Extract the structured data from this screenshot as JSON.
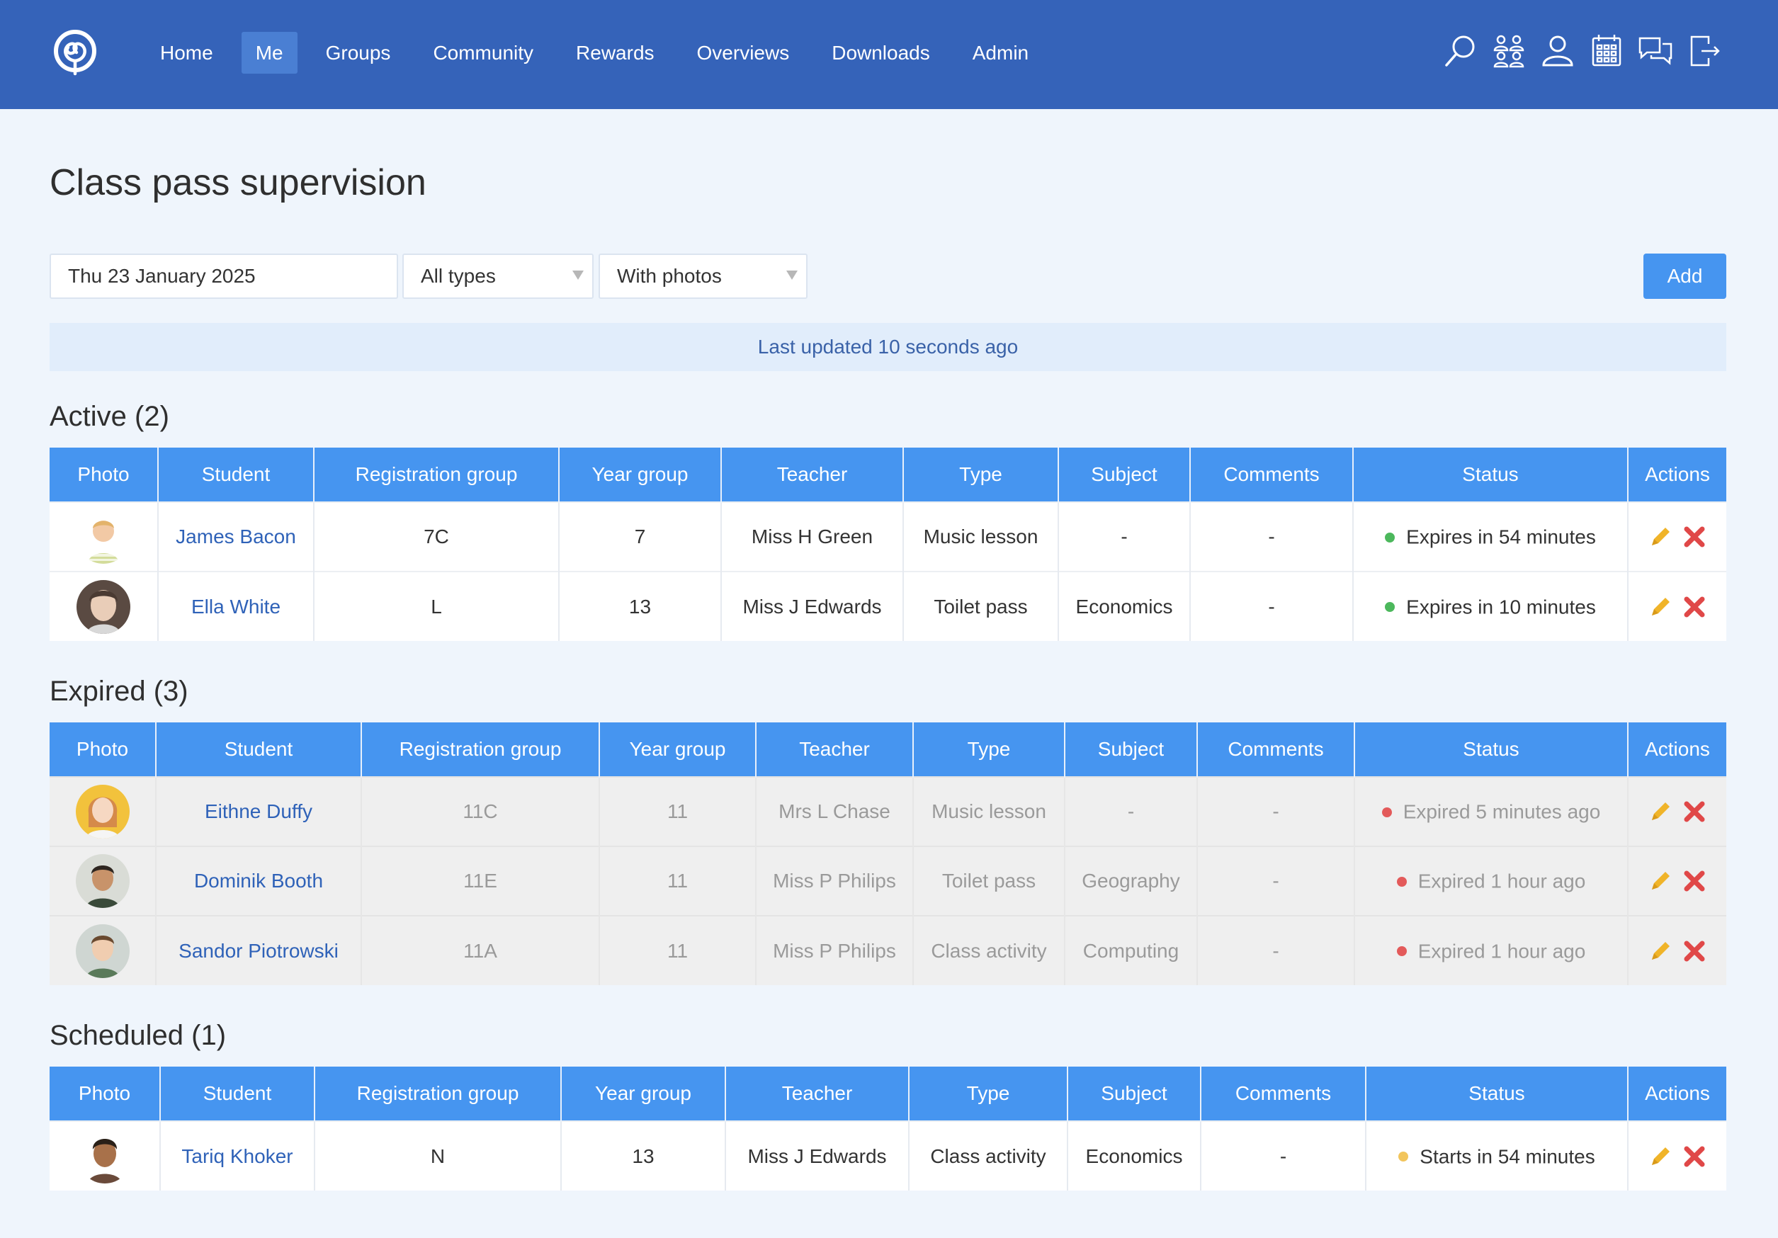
{
  "nav": {
    "items": [
      {
        "label": "Home",
        "active": false
      },
      {
        "label": "Me",
        "active": true
      },
      {
        "label": "Groups",
        "active": false
      },
      {
        "label": "Community",
        "active": false
      },
      {
        "label": "Rewards",
        "active": false
      },
      {
        "label": "Overviews",
        "active": false
      },
      {
        "label": "Downloads",
        "active": false
      },
      {
        "label": "Admin",
        "active": false
      }
    ],
    "icons": [
      "search-icon",
      "groups-icon",
      "user-icon",
      "calendar-icon",
      "messages-icon",
      "logout-icon"
    ]
  },
  "page": {
    "title": "Class pass supervision"
  },
  "filters": {
    "date": "Thu 23 January 2025",
    "type": "All types",
    "photos": "With photos",
    "add_label": "Add"
  },
  "updated": "Last updated 10 seconds ago",
  "colors": {
    "topbar": "#3563b9",
    "header": "#4695f0",
    "active_status": "#4cb85c",
    "expired_status": "#e35a5a",
    "scheduled_status": "#f2c55c",
    "edit": "#f0b429",
    "delete": "#e04848"
  },
  "sections": {
    "active": {
      "title": "Active (2)",
      "headers": [
        "Photo",
        "Student",
        "Registration group",
        "Year group",
        "Teacher",
        "Type",
        "Subject",
        "Comments",
        "Status",
        "Actions"
      ],
      "rows": [
        {
          "student": "James Bacon",
          "reg": "7C",
          "year": "7",
          "teacher": "Miss H Green",
          "type": "Music lesson",
          "subject": "-",
          "comments": "-",
          "status": "Expires in 54 minutes"
        },
        {
          "student": "Ella White",
          "reg": "L",
          "year": "13",
          "teacher": "Miss J Edwards",
          "type": "Toilet pass",
          "subject": "Economics",
          "comments": "-",
          "status": "Expires in 10 minutes"
        }
      ]
    },
    "expired": {
      "title": "Expired (3)",
      "headers": [
        "Photo",
        "Student",
        "Registration group",
        "Year group",
        "Teacher",
        "Type",
        "Subject",
        "Comments",
        "Status",
        "Actions"
      ],
      "rows": [
        {
          "student": "Eithne Duffy",
          "reg": "11C",
          "year": "11",
          "teacher": "Mrs L Chase",
          "type": "Music lesson",
          "subject": "-",
          "comments": "-",
          "status": "Expired 5 minutes ago"
        },
        {
          "student": "Dominik Booth",
          "reg": "11E",
          "year": "11",
          "teacher": "Miss P Philips",
          "type": "Toilet pass",
          "subject": "Geography",
          "comments": "-",
          "status": "Expired 1 hour ago"
        },
        {
          "student": "Sandor Piotrowski",
          "reg": "11A",
          "year": "11",
          "teacher": "Miss P Philips",
          "type": "Class activity",
          "subject": "Computing",
          "comments": "-",
          "status": "Expired 1 hour ago"
        }
      ]
    },
    "scheduled": {
      "title": "Scheduled (1)",
      "headers": [
        "Photo",
        "Student",
        "Registration group",
        "Year group",
        "Teacher",
        "Type",
        "Subject",
        "Comments",
        "Status",
        "Actions"
      ],
      "rows": [
        {
          "student": "Tariq Khoker",
          "reg": "N",
          "year": "13",
          "teacher": "Miss J Edwards",
          "type": "Class activity",
          "subject": "Economics",
          "comments": "-",
          "status": "Starts in 54 minutes"
        }
      ]
    }
  }
}
